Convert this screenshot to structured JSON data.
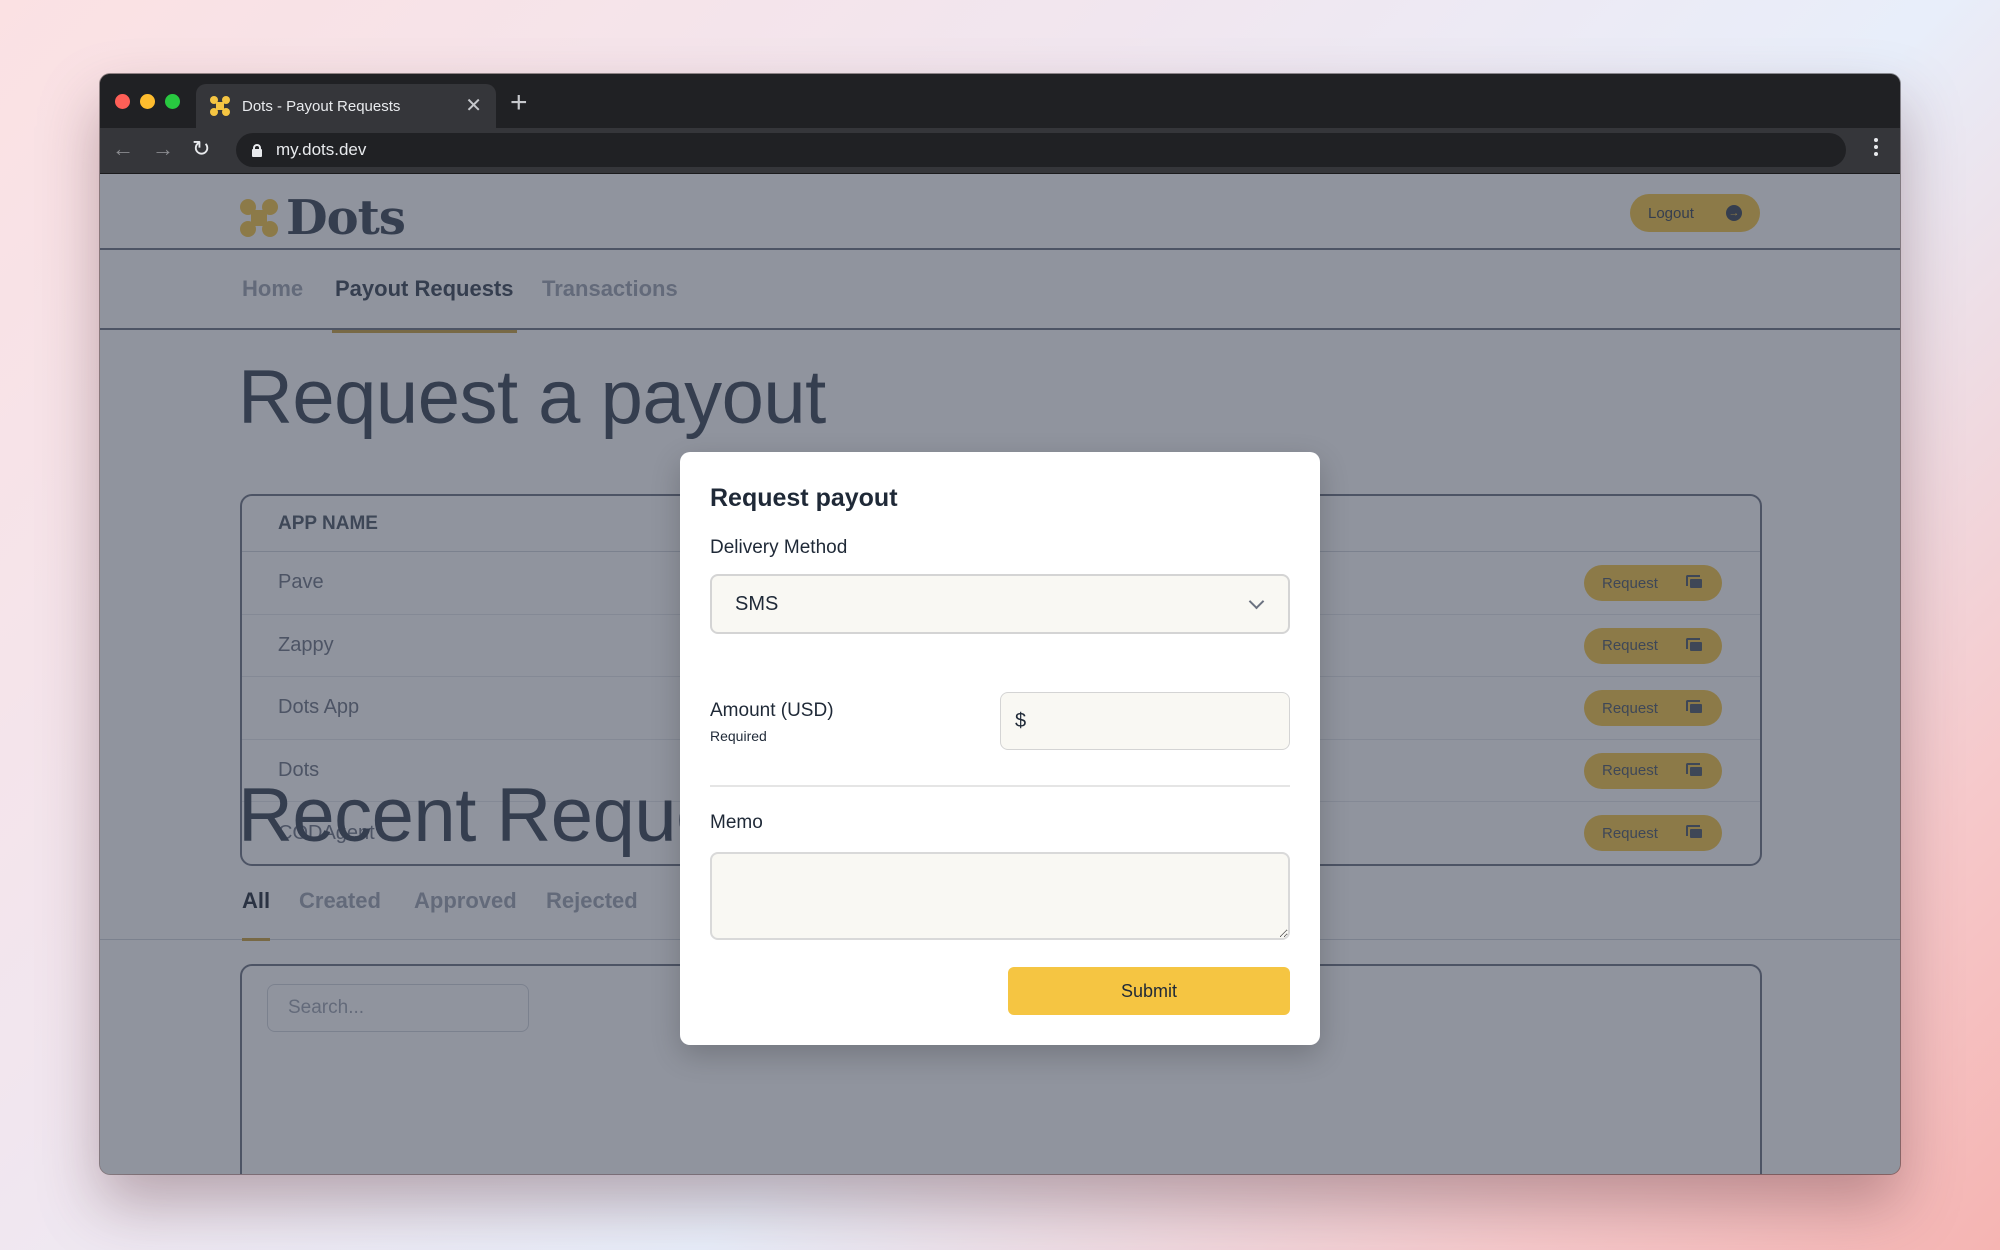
{
  "browser": {
    "tab_title": "Dots - Payout Requests",
    "url": "my.dots.dev",
    "favicon_color": "#f5c542"
  },
  "header": {
    "logo_text": "Dots",
    "logout_label": "Logout"
  },
  "nav": {
    "items": [
      {
        "label": "Home",
        "active": false
      },
      {
        "label": "Payout Requests",
        "active": true
      },
      {
        "label": "Transactions",
        "active": false
      }
    ]
  },
  "request_section": {
    "title": "Request a payout",
    "column_header": "APP NAME",
    "apps": [
      {
        "name": "Pave",
        "action": "Request"
      },
      {
        "name": "Zappy",
        "action": "Request"
      },
      {
        "name": "Dots App",
        "action": "Request"
      },
      {
        "name": "Dots",
        "action": "Request"
      },
      {
        "name": "CODAgent",
        "action": "Request"
      }
    ]
  },
  "recent_section": {
    "title": "Recent Requests",
    "tabs": [
      {
        "label": "All",
        "active": true
      },
      {
        "label": "Created",
        "active": false
      },
      {
        "label": "Approved",
        "active": false
      },
      {
        "label": "Rejected",
        "active": false
      }
    ],
    "search_placeholder": "Search..."
  },
  "modal": {
    "title": "Request payout",
    "delivery_label": "Delivery Method",
    "delivery_value": "SMS",
    "amount_label": "Amount (USD)",
    "amount_required": "Required",
    "amount_prefix": "$",
    "amount_value": "",
    "memo_label": "Memo",
    "memo_value": "",
    "submit_label": "Submit"
  },
  "colors": {
    "accent": "#f5c542",
    "overlay": "#343c4e"
  }
}
